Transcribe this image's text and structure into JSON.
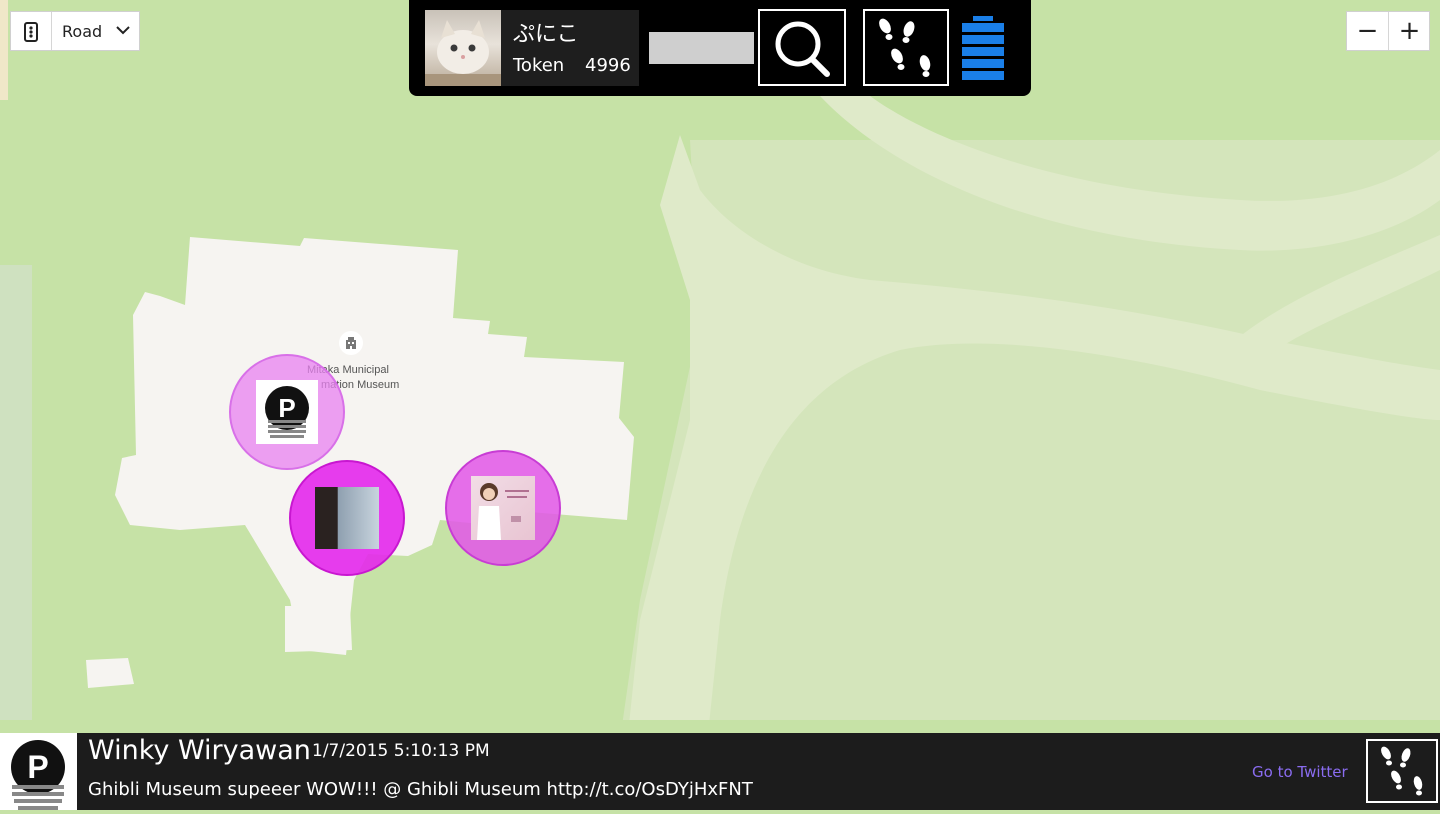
{
  "map": {
    "style_control": {
      "label": "Road",
      "icon": "traffic-light-icon",
      "dropdown_icon": "chevron-down-icon"
    },
    "zoom": {
      "out_label": "−",
      "in_label": "+"
    },
    "poi": {
      "name_line1": "Mitaka Municipal",
      "name_line2": "mation Museum",
      "icon": "building-icon"
    },
    "pins": [
      {
        "name": "pin-winky",
        "color": "#e88ef0"
      },
      {
        "name": "pin-photo-person",
        "color": "#e43ce8"
      },
      {
        "name": "pin-photo-woman",
        "color": "#e256e8"
      }
    ],
    "colors": {
      "park": "#c6e2a6",
      "path": "#dfeac9",
      "building": "#f6f4f1",
      "meadow": "#d4e5bb"
    }
  },
  "topbar": {
    "user_name": "ぷにこ",
    "token_label": "Token",
    "token_value": "4996",
    "search_icon": "search-icon",
    "footsteps_icon": "footsteps-icon",
    "battery_icon": "battery-icon",
    "battery_color": "#1a7fe8"
  },
  "tweet": {
    "user": "Winky Wiryawan",
    "timestamp": "1/7/2015 5:10:13 PM",
    "text": "Ghibli Museum supeeer WOW!!! @ Ghibli Museum http://t.co/OsDYjHxFNT",
    "link_label": "Go to Twitter",
    "link_color": "#8a6cf0",
    "footsteps_icon": "footsteps-icon"
  }
}
